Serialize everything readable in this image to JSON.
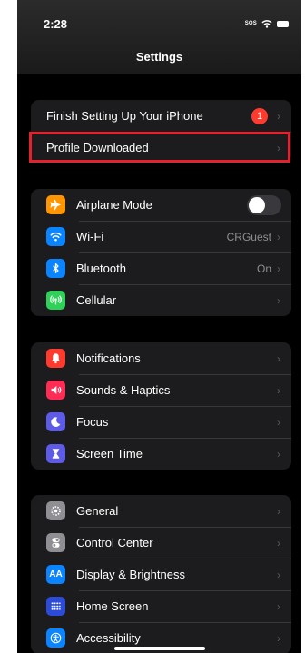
{
  "status_bar": {
    "time": "2:28",
    "sos": "SOS"
  },
  "nav": {
    "title": "Settings"
  },
  "group1": {
    "items": [
      {
        "label": "Finish Setting Up Your iPhone",
        "badge": "1"
      },
      {
        "label": "Profile Downloaded"
      }
    ]
  },
  "group2": {
    "items": [
      {
        "label": "Airplane Mode",
        "icon": "airplane-icon",
        "icon_color": "#ff9500",
        "toggle_on": false
      },
      {
        "label": "Wi-Fi",
        "icon": "wifi-icon",
        "icon_color": "#0a84ff",
        "value": "CRGuest"
      },
      {
        "label": "Bluetooth",
        "icon": "bluetooth-icon",
        "icon_color": "#0a84ff",
        "value": "On"
      },
      {
        "label": "Cellular",
        "icon": "cellular-icon",
        "icon_color": "#30d158"
      }
    ]
  },
  "group3": {
    "items": [
      {
        "label": "Notifications",
        "icon": "bell-icon",
        "icon_color": "#ff3b30"
      },
      {
        "label": "Sounds & Haptics",
        "icon": "speaker-icon",
        "icon_color": "#ff2d55"
      },
      {
        "label": "Focus",
        "icon": "moon-icon",
        "icon_color": "#5e5ce6"
      },
      {
        "label": "Screen Time",
        "icon": "hourglass-icon",
        "icon_color": "#5e5ce6"
      }
    ]
  },
  "group4": {
    "items": [
      {
        "label": "General",
        "icon": "gear-icon",
        "icon_color": "#8e8e93"
      },
      {
        "label": "Control Center",
        "icon": "switches-icon",
        "icon_color": "#8e8e93"
      },
      {
        "label": "Display & Brightness",
        "icon": "text-size-icon",
        "icon_color": "#0a84ff",
        "icon_text": "AA"
      },
      {
        "label": "Home Screen",
        "icon": "grid-icon",
        "icon_color": "#2c4bd8"
      },
      {
        "label": "Accessibility",
        "icon": "accessibility-icon",
        "icon_color": "#0a84ff"
      }
    ]
  },
  "chevron": "›",
  "highlight_color": "#e4212c"
}
